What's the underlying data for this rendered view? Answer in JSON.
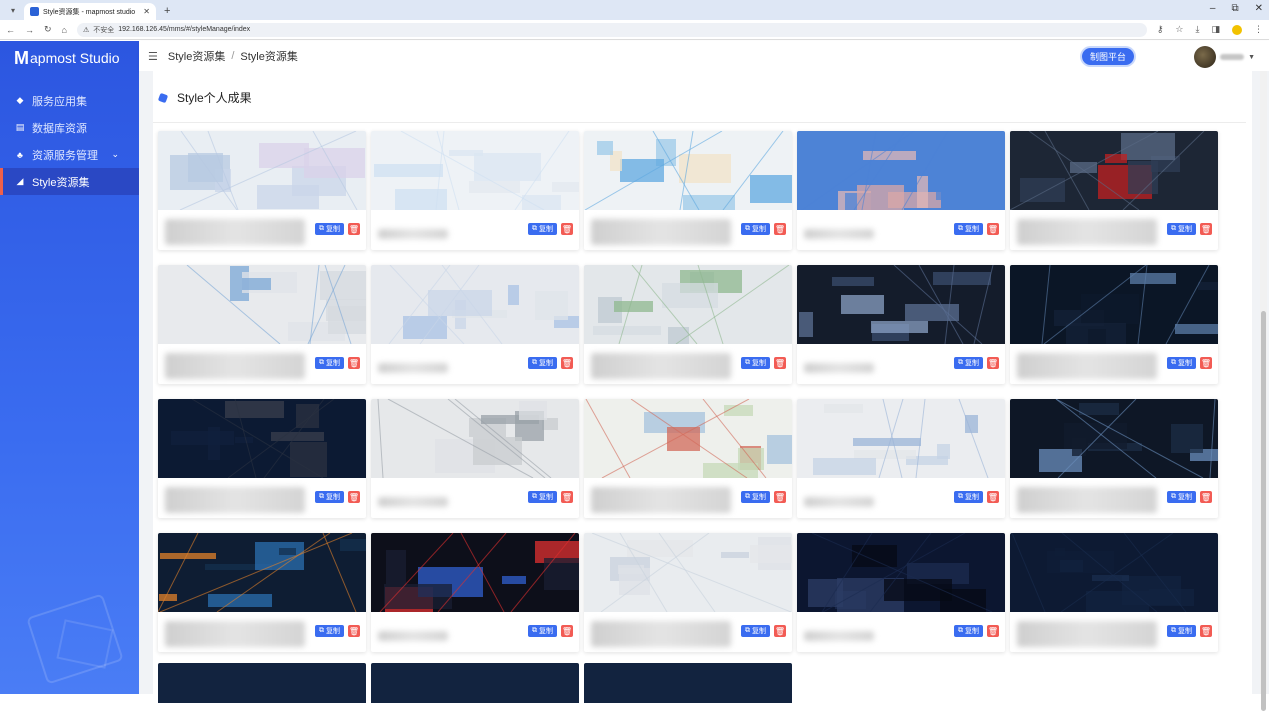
{
  "browser": {
    "tab_title": "Style资源集 - mapmost studio",
    "url_warning": "不安全",
    "url": "192.168.126.45/mms/#/styleManage/index"
  },
  "sidebar": {
    "logo": "apmost Studio",
    "logo_mark": "M",
    "items": [
      {
        "label": "服务应用集",
        "icon": "layers-icon"
      },
      {
        "label": "数据库资源",
        "icon": "database-icon"
      },
      {
        "label": "资源服务管理",
        "icon": "cluster-icon",
        "chevron": "⌄"
      },
      {
        "label": "Style资源集",
        "icon": "style-icon",
        "active": true
      }
    ]
  },
  "header": {
    "breadcrumb": [
      "Style资源集",
      "Style资源集"
    ],
    "platform_button": "制图平台"
  },
  "section": {
    "title": "Style个人成果"
  },
  "card_actions": {
    "copy_label": "复制",
    "copy_icon": "copy-icon",
    "delete_icon": "trash-icon"
  },
  "cards": [
    {
      "theme": "light-city"
    },
    {
      "theme": "light-plain"
    },
    {
      "theme": "light-blue-water"
    },
    {
      "theme": "pink-sea"
    },
    {
      "theme": "dark-3d"
    },
    {
      "theme": "light-gray-dots"
    },
    {
      "theme": "light-lake"
    },
    {
      "theme": "light-3d"
    },
    {
      "theme": "dark-3d-blue"
    },
    {
      "theme": "dark-dots"
    },
    {
      "theme": "dark-navy"
    },
    {
      "theme": "light-3d-gray"
    },
    {
      "theme": "colored-roads"
    },
    {
      "theme": "light-gray-lakes"
    },
    {
      "theme": "dark-lakes"
    },
    {
      "theme": "dark-roads-orange"
    },
    {
      "theme": "dark-metro"
    },
    {
      "theme": "light-faint"
    },
    {
      "theme": "dark-admin"
    },
    {
      "theme": "dark-navy-plain"
    }
  ],
  "colors": {
    "accent": "#3a6cf0",
    "danger": "#f25b54",
    "sidebar_active": "#2a48c4"
  }
}
